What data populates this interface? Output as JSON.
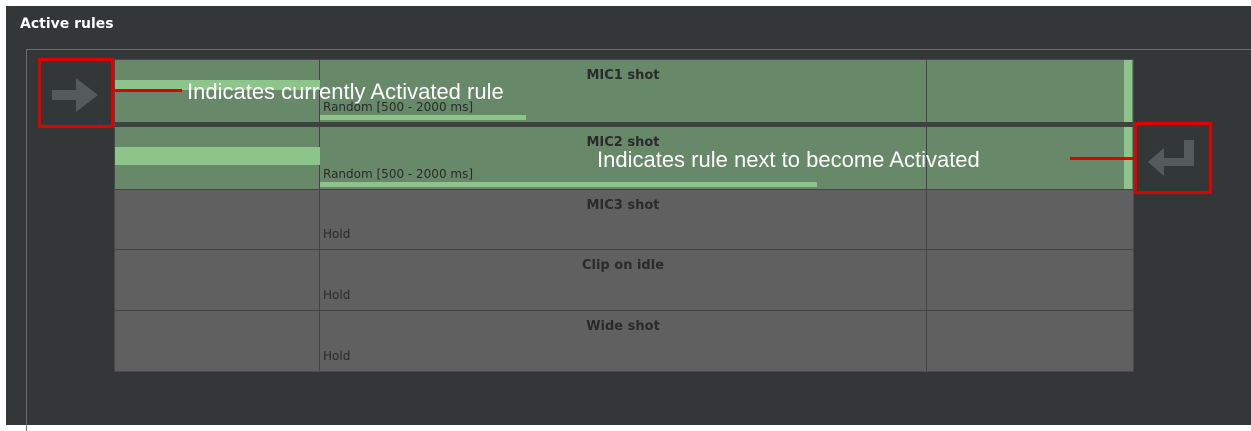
{
  "panel": {
    "title": "Active rules"
  },
  "rules": [
    {
      "name": "MIC1 shot",
      "sub": "Random [500 - 2000 ms]",
      "state": "current",
      "progress_fraction": 0.34
    },
    {
      "name": "MIC2 shot",
      "sub": "Random [500 - 2000 ms]",
      "state": "next",
      "progress_fraction": 0.82
    },
    {
      "name": "MIC3 shot",
      "sub": "Hold",
      "state": "inactive"
    },
    {
      "name": "Clip on idle",
      "sub": "Hold",
      "state": "inactive"
    },
    {
      "name": "Wide shot",
      "sub": "Hold",
      "state": "inactive"
    }
  ],
  "annotations": {
    "current": "Indicates currently Activated rule",
    "next": "Indicates rule next to become Activated"
  },
  "icons": {
    "current": "arrow-right-icon",
    "next": "return-enter-icon"
  },
  "colors": {
    "active_row": "#67896a",
    "progress_green": "#8dc48a",
    "inactive_row": "#606060",
    "annotation_red": "#e00000"
  }
}
